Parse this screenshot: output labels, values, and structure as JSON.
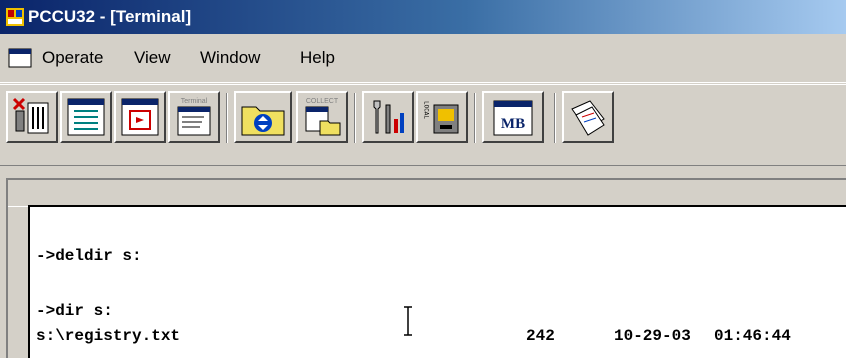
{
  "window": {
    "title": "PCCU32 - [Terminal]"
  },
  "menu": {
    "items": [
      "Operate",
      "View",
      "Window",
      "Help"
    ]
  },
  "toolbar": {
    "buttons": [
      {
        "icon": "disconnect-icon"
      },
      {
        "icon": "entry-screen-icon"
      },
      {
        "icon": "window-refresh-icon"
      },
      {
        "icon": "terminal-icon",
        "label": "Terminal"
      },
      {
        "icon": "folder-sync-icon"
      },
      {
        "icon": "collect-icon",
        "label": "COLLECT"
      },
      {
        "icon": "tools-icon"
      },
      {
        "icon": "local-icon",
        "label": "LOCAL"
      },
      {
        "icon": "mb-icon",
        "label": "MB"
      },
      {
        "icon": "report-icon"
      }
    ]
  },
  "terminal": {
    "lines": [
      {
        "text": "->deldir s:"
      },
      {
        "text": "->dir s:"
      },
      {
        "text": "s:\\registry.txt",
        "size": "242",
        "date": "10-29-03",
        "time": "01:46:44"
      }
    ]
  }
}
